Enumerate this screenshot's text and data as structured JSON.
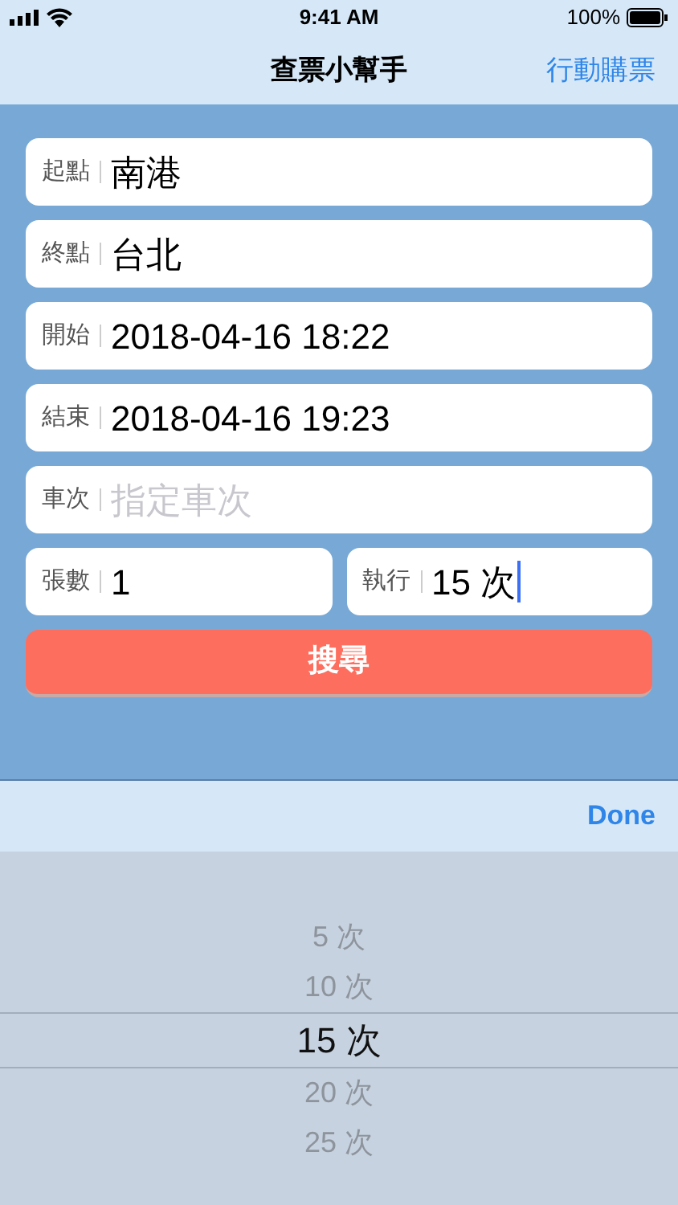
{
  "status_bar": {
    "time": "9:41 AM",
    "battery": "100%"
  },
  "nav": {
    "title": "查票小幫手",
    "action": "行動購票"
  },
  "form": {
    "rows": [
      [
        {
          "label": "起點",
          "value": "南港",
          "focused": false
        }
      ],
      [
        {
          "label": "終點",
          "value": "台北",
          "focused": false
        }
      ],
      [
        {
          "label": "開始",
          "value": "2018-04-16 18:22",
          "focused": false
        }
      ],
      [
        {
          "label": "結束",
          "value": "2018-04-16 19:23",
          "focused": false
        }
      ],
      [
        {
          "label": "車次",
          "placeholder": "指定車次",
          "focused": false
        }
      ],
      [
        {
          "label": "張數",
          "value": "1",
          "focused": false
        },
        {
          "label": "執行",
          "value": "15 次",
          "focused": true
        }
      ]
    ],
    "submit": "搜尋"
  },
  "toolbar": {
    "done": "Done"
  },
  "picker": {
    "options": [
      {
        "label": "5 次",
        "selected": false
      },
      {
        "label": "10 次",
        "selected": false
      },
      {
        "label": "15 次",
        "selected": true
      },
      {
        "label": "20 次",
        "selected": false
      },
      {
        "label": "25 次",
        "selected": false
      }
    ]
  }
}
